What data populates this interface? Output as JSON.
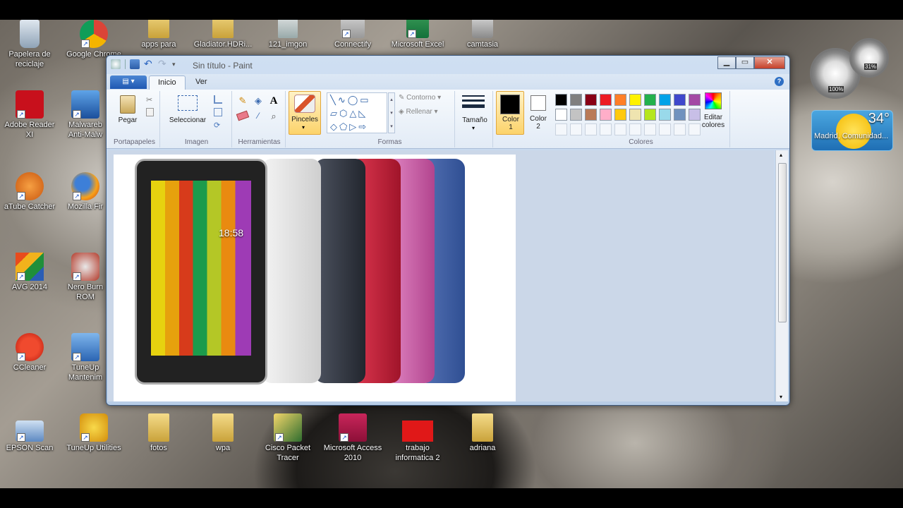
{
  "window": {
    "title": "Sin título - Paint"
  },
  "tabs": [
    {
      "label": "Inicio"
    },
    {
      "label": "Ver"
    }
  ],
  "ribbon": {
    "clipboard": {
      "paste": "Pegar",
      "group": "Portapapeles"
    },
    "image": {
      "select": "Seleccionar",
      "group": "Imagen"
    },
    "tools": {
      "group": "Herramientas"
    },
    "brushes": {
      "label": "Pinceles"
    },
    "shapes": {
      "outline": "Contorno",
      "fill": "Rellenar",
      "group": "Formas"
    },
    "size": {
      "label": "Tamaño"
    },
    "color1": {
      "label": "Color 1"
    },
    "color2": {
      "label": "Color 2"
    },
    "colors": {
      "edit": "Editar colores",
      "group": "Colores"
    }
  },
  "palette": [
    "#000000",
    "#7f7f7f",
    "#880015",
    "#ed1c24",
    "#ff7f27",
    "#fff200",
    "#22b14c",
    "#00a2e8",
    "#3f48cc",
    "#a349a4",
    "#ffffff",
    "#c3c3c3",
    "#b97a57",
    "#ffaec9",
    "#ffc90e",
    "#efe4b0",
    "#b5e61d",
    "#99d9ea",
    "#7092be",
    "#c8bfe7"
  ],
  "canvas": {
    "clock": "18:58"
  },
  "desktop": {
    "icons_left": [
      "Papelera de reciclaje",
      "Adobe Reader XI",
      "aTube Catcher",
      "AVG 2014",
      "CCleaner",
      "EPSON Scan"
    ],
    "icons_col2": [
      "Google Chrome",
      "Malwareb Anti-Malw",
      "Mozilla Fir",
      "Nero Burn ROM",
      "TuneUp Mantenim",
      "TuneUp Utilities"
    ],
    "icons_top": [
      "apps para",
      "Gladiator.HDRi...",
      "121_imgon",
      "Connectify",
      "Microsoft Excel",
      "camtasia"
    ],
    "icons_bottom": [
      "fotos",
      "wpa",
      "Cisco Packet Tracer",
      "Microsoft Access 2010",
      "trabajo informatica 2",
      "adriana"
    ]
  },
  "gadgets": {
    "cpu": "100%",
    "mem": "31%",
    "temp": "34°",
    "city": "Madrid, Comunidad..."
  }
}
